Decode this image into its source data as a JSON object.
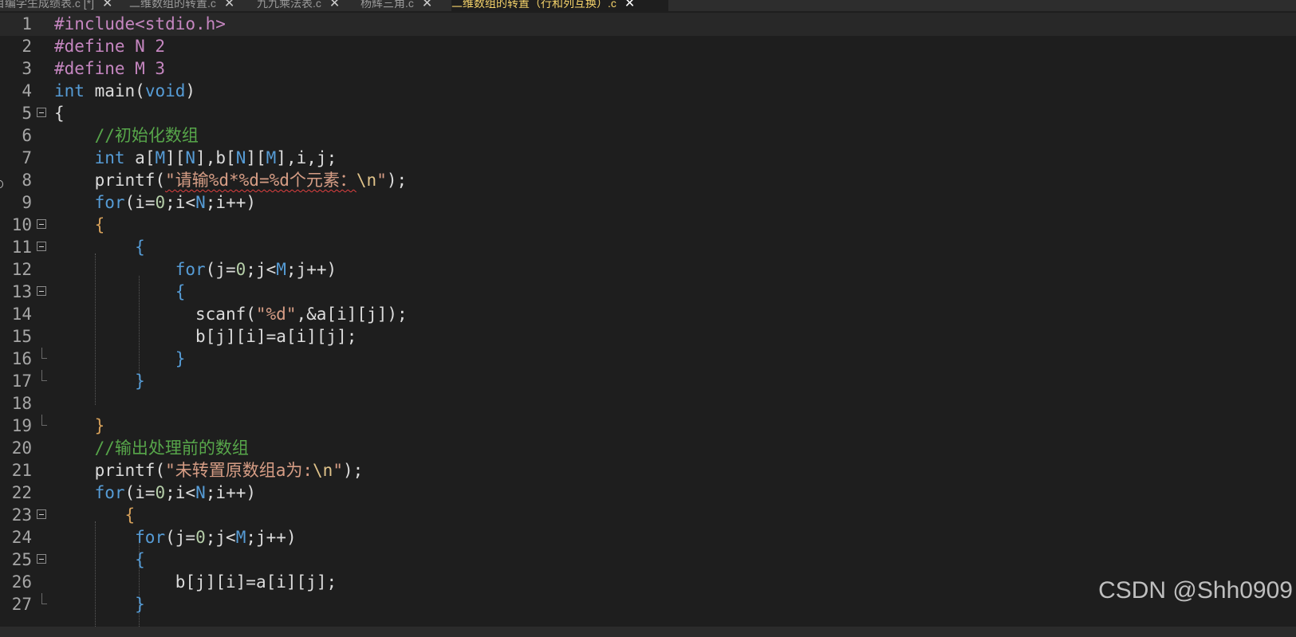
{
  "tabs": [
    {
      "label": "目编学生成绩表.c [*]",
      "close": "✕",
      "active": false
    },
    {
      "label": "二维数组的转置.c",
      "close": "✕",
      "active": false
    },
    {
      "label": "九九乘法表.c",
      "close": "✕",
      "active": false
    },
    {
      "label": "杨辉三角.c",
      "close": "✕",
      "active": false
    },
    {
      "label": "二维数组的转置（行和列互换）.c",
      "close": "✕",
      "active": true
    }
  ],
  "editor": {
    "current_line": 1,
    "lines": [
      {
        "n": "1",
        "fold": "",
        "tokens": [
          [
            "pp",
            "#include<stdio.h>"
          ]
        ]
      },
      {
        "n": "2",
        "fold": "",
        "tokens": [
          [
            "pp",
            "#define N 2"
          ]
        ]
      },
      {
        "n": "3",
        "fold": "",
        "tokens": [
          [
            "pp",
            "#define M 3"
          ]
        ]
      },
      {
        "n": "4",
        "fold": "",
        "tokens": [
          [
            "kw",
            "int"
          ],
          [
            "id",
            " main"
          ],
          [
            "pn",
            "("
          ],
          [
            "kw",
            "void"
          ],
          [
            "pn",
            ")"
          ]
        ]
      },
      {
        "n": "5",
        "fold": "open",
        "tokens": [
          [
            "pn",
            "{"
          ]
        ]
      },
      {
        "n": "6",
        "fold": "",
        "tokens": [
          [
            "sp",
            "    "
          ],
          [
            "cm",
            "//初始化数组"
          ]
        ]
      },
      {
        "n": "7",
        "fold": "",
        "tokens": [
          [
            "sp",
            "    "
          ],
          [
            "kw",
            "int"
          ],
          [
            "id",
            " a"
          ],
          [
            "pn",
            "["
          ],
          [
            "kw",
            "M"
          ],
          [
            "pn",
            "]["
          ],
          [
            "kw",
            "N"
          ],
          [
            "pn",
            "],"
          ],
          [
            "id",
            "b"
          ],
          [
            "pn",
            "["
          ],
          [
            "kw",
            "N"
          ],
          [
            "pn",
            "]["
          ],
          [
            "kw",
            "M"
          ],
          [
            "pn",
            "],"
          ],
          [
            "id",
            "i"
          ],
          [
            "pn",
            ","
          ],
          [
            "id",
            "j"
          ],
          [
            "pn",
            ";"
          ]
        ]
      },
      {
        "n": "8",
        "fold": "",
        "tokens": [
          [
            "sp",
            "    "
          ],
          [
            "id",
            "printf"
          ],
          [
            "pn",
            "("
          ],
          [
            "strsq",
            "\"请输%d*%d=%d个元素："
          ],
          [
            "esc",
            "\\n"
          ],
          [
            "str",
            "\""
          ],
          [
            "pn",
            ");"
          ]
        ]
      },
      {
        "n": "9",
        "fold": "",
        "tokens": [
          [
            "sp",
            "    "
          ],
          [
            "kw",
            "for"
          ],
          [
            "pn",
            "("
          ],
          [
            "id",
            "i"
          ],
          [
            "pn",
            "="
          ],
          [
            "num",
            "0"
          ],
          [
            "pn",
            ";"
          ],
          [
            "id",
            "i"
          ],
          [
            "pn",
            "<"
          ],
          [
            "kw",
            "N"
          ],
          [
            "pn",
            ";"
          ],
          [
            "id",
            "i"
          ],
          [
            "pn",
            "++)"
          ]
        ]
      },
      {
        "n": "10",
        "fold": "open",
        "tokens": [
          [
            "sp",
            "    "
          ],
          [
            "br1",
            "{"
          ]
        ]
      },
      {
        "n": "11",
        "fold": "open",
        "tokens": [
          [
            "sp",
            "        "
          ],
          [
            "br2",
            "{"
          ]
        ]
      },
      {
        "n": "12",
        "fold": "",
        "tokens": [
          [
            "sp",
            "            "
          ],
          [
            "kw",
            "for"
          ],
          [
            "pn",
            "("
          ],
          [
            "id",
            "j"
          ],
          [
            "pn",
            "="
          ],
          [
            "num",
            "0"
          ],
          [
            "pn",
            ";"
          ],
          [
            "id",
            "j"
          ],
          [
            "pn",
            "<"
          ],
          [
            "kw",
            "M"
          ],
          [
            "pn",
            ";"
          ],
          [
            "id",
            "j"
          ],
          [
            "pn",
            "++)"
          ]
        ]
      },
      {
        "n": "13",
        "fold": "open",
        "tokens": [
          [
            "sp",
            "            "
          ],
          [
            "br2",
            "{"
          ]
        ]
      },
      {
        "n": "14",
        "fold": "",
        "tokens": [
          [
            "sp",
            "              "
          ],
          [
            "id",
            "scanf"
          ],
          [
            "pn",
            "("
          ],
          [
            "str",
            "\"%d\""
          ],
          [
            "pn",
            ",&"
          ],
          [
            "id",
            "a"
          ],
          [
            "pn",
            "["
          ],
          [
            "id",
            "i"
          ],
          [
            "pn",
            "]["
          ],
          [
            "id",
            "j"
          ],
          [
            "pn",
            "]);"
          ]
        ]
      },
      {
        "n": "15",
        "fold": "",
        "tokens": [
          [
            "sp",
            "              "
          ],
          [
            "id",
            "b"
          ],
          [
            "pn",
            "["
          ],
          [
            "id",
            "j"
          ],
          [
            "pn",
            "]["
          ],
          [
            "id",
            "i"
          ],
          [
            "pn",
            "]="
          ],
          [
            "id",
            "a"
          ],
          [
            "pn",
            "["
          ],
          [
            "id",
            "i"
          ],
          [
            "pn",
            "]["
          ],
          [
            "id",
            "j"
          ],
          [
            "pn",
            "];"
          ]
        ]
      },
      {
        "n": "16",
        "fold": "end",
        "tokens": [
          [
            "sp",
            "            "
          ],
          [
            "br2",
            "}"
          ]
        ]
      },
      {
        "n": "17",
        "fold": "end",
        "tokens": [
          [
            "sp",
            "        "
          ],
          [
            "br2",
            "}"
          ]
        ]
      },
      {
        "n": "18",
        "fold": "",
        "tokens": []
      },
      {
        "n": "19",
        "fold": "end",
        "tokens": [
          [
            "sp",
            "    "
          ],
          [
            "br1",
            "}"
          ]
        ]
      },
      {
        "n": "20",
        "fold": "",
        "tokens": [
          [
            "sp",
            "    "
          ],
          [
            "cm",
            "//输出处理前的数组"
          ]
        ]
      },
      {
        "n": "21",
        "fold": "",
        "tokens": [
          [
            "sp",
            "    "
          ],
          [
            "id",
            "printf"
          ],
          [
            "pn",
            "("
          ],
          [
            "str",
            "\"未转置原数组a为:"
          ],
          [
            "esc",
            "\\n"
          ],
          [
            "str",
            "\""
          ],
          [
            "pn",
            ");"
          ]
        ]
      },
      {
        "n": "22",
        "fold": "",
        "tokens": [
          [
            "sp",
            "    "
          ],
          [
            "kw",
            "for"
          ],
          [
            "pn",
            "("
          ],
          [
            "id",
            "i"
          ],
          [
            "pn",
            "="
          ],
          [
            "num",
            "0"
          ],
          [
            "pn",
            ";"
          ],
          [
            "id",
            "i"
          ],
          [
            "pn",
            "<"
          ],
          [
            "kw",
            "N"
          ],
          [
            "pn",
            ";"
          ],
          [
            "id",
            "i"
          ],
          [
            "pn",
            "++)"
          ]
        ]
      },
      {
        "n": "23",
        "fold": "open",
        "tokens": [
          [
            "sp",
            "       "
          ],
          [
            "br1",
            "{"
          ]
        ]
      },
      {
        "n": "24",
        "fold": "",
        "tokens": [
          [
            "sp",
            "        "
          ],
          [
            "kw",
            "for"
          ],
          [
            "pn",
            "("
          ],
          [
            "id",
            "j"
          ],
          [
            "pn",
            "="
          ],
          [
            "num",
            "0"
          ],
          [
            "pn",
            ";"
          ],
          [
            "id",
            "j"
          ],
          [
            "pn",
            "<"
          ],
          [
            "kw",
            "M"
          ],
          [
            "pn",
            ";"
          ],
          [
            "id",
            "j"
          ],
          [
            "pn",
            "++)"
          ]
        ]
      },
      {
        "n": "25",
        "fold": "open",
        "tokens": [
          [
            "sp",
            "        "
          ],
          [
            "br2",
            "{"
          ]
        ]
      },
      {
        "n": "26",
        "fold": "",
        "tokens": [
          [
            "sp",
            "            "
          ],
          [
            "id",
            "b"
          ],
          [
            "pn",
            "["
          ],
          [
            "id",
            "j"
          ],
          [
            "pn",
            "]["
          ],
          [
            "id",
            "i"
          ],
          [
            "pn",
            "]="
          ],
          [
            "id",
            "a"
          ],
          [
            "pn",
            "["
          ],
          [
            "id",
            "i"
          ],
          [
            "pn",
            "]["
          ],
          [
            "id",
            "j"
          ],
          [
            "pn",
            "];"
          ]
        ]
      },
      {
        "n": "27",
        "fold": "end",
        "tokens": [
          [
            "sp",
            "        "
          ],
          [
            "br2",
            "}"
          ]
        ]
      }
    ]
  },
  "watermark": "CSDN @Shh0909"
}
